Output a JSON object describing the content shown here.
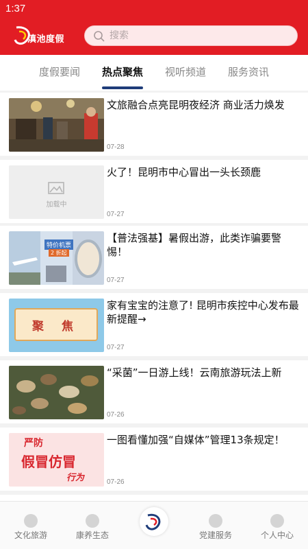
{
  "status_bar": {
    "time": "1:37"
  },
  "header": {
    "logo_text": "滇池度假",
    "search_placeholder": "搜索"
  },
  "tabs": [
    {
      "label": "度假要闻",
      "active": false
    },
    {
      "label": "热点聚焦",
      "active": true
    },
    {
      "label": "视听频道",
      "active": false
    },
    {
      "label": "服务资讯",
      "active": false
    }
  ],
  "articles": [
    {
      "title": "文旅融合点亮昆明夜经济 商业活力焕发",
      "date": "07-28",
      "thumb": "night-market-photo"
    },
    {
      "title": "火了！昆明市中心冒出一头长颈鹿",
      "date": "07-27",
      "thumb": "loading-placeholder",
      "thumb_text": "加载中"
    },
    {
      "title": "【普法强基】暑假出游，此类诈骗要警惕！",
      "date": "07-27",
      "thumb": "airplane-ticket-collage",
      "thumb_text": "特价机票",
      "thumb_text2": "2 折起"
    },
    {
      "title": "家有宝宝的注意了! 昆明市疾控中心发布最新提醒→",
      "date": "07-27",
      "thumb": "focus-banner",
      "thumb_text": "聚 焦"
    },
    {
      "title": "“采菌”一日游上线！云南旅游玩法上新",
      "date": "07-26",
      "thumb": "mushrooms-photo"
    },
    {
      "title": "一图看懂加强“自媒体”管理13条规定！",
      "date": "07-26",
      "thumb": "anti-counterfeit-poster",
      "thumb_text": "严防",
      "thumb_text2": "假冒仿冒",
      "thumb_text3": "行为"
    }
  ],
  "bottom_nav": [
    {
      "label": "文化旅游"
    },
    {
      "label": "康养生态"
    },
    {
      "label": ""
    },
    {
      "label": "党建服务"
    },
    {
      "label": "个人中心"
    }
  ],
  "colors": {
    "brand_red": "#e21d24",
    "tab_underline": "#1f3d7a"
  }
}
